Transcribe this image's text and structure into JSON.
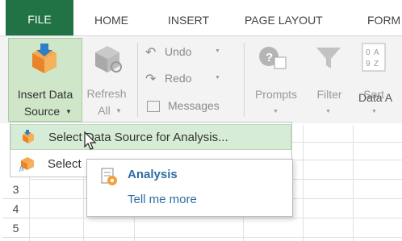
{
  "tabs": [
    "FILE",
    "HOME",
    "INSERT",
    "PAGE LAYOUT",
    "FORM"
  ],
  "ribbon": {
    "insert_data_source": {
      "line1": "Insert Data",
      "line2": "Source"
    },
    "refresh": {
      "line1": "Refresh",
      "line2": "All"
    },
    "undo": "Undo",
    "redo": "Redo",
    "messages": "Messages",
    "prompts": "Prompts",
    "filter": "Filter",
    "sort": "Sort",
    "group_label": "Data A"
  },
  "dropdown": {
    "items": [
      {
        "label": "Select Data Source for Analysis...",
        "icon": "cube-data-icon",
        "highlighted": true
      },
      {
        "label": "Select",
        "icon": "formula-cube-icon",
        "highlighted": false
      }
    ]
  },
  "tooltip": {
    "title": "Analysis",
    "link": "Tell me more"
  },
  "grid": {
    "rows": [
      "3",
      "4",
      "5"
    ]
  },
  "colors": {
    "accent": "#217346",
    "highlight": "#d6ecd6",
    "link": "#2e6da4"
  }
}
